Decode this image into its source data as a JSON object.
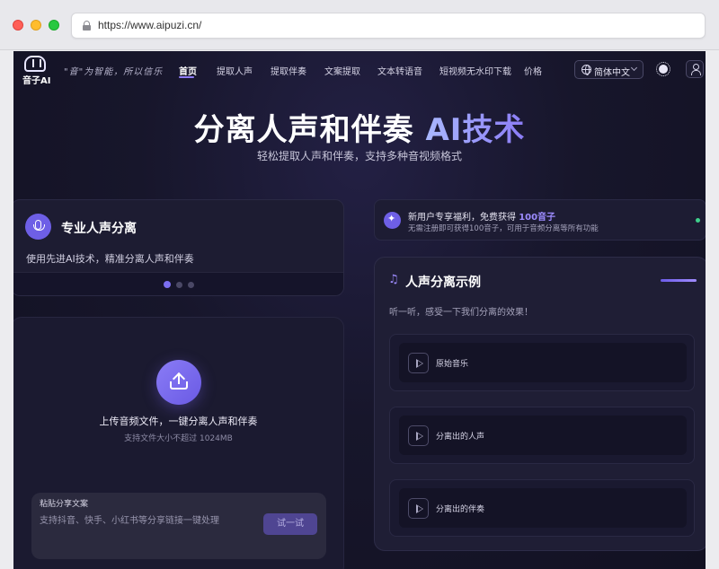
{
  "browser": {
    "url": "https://www.aipuzi.cn/"
  },
  "nav": {
    "logo_text": "音子AI",
    "slogan": "\"音\"为智能，所以信乐",
    "items": [
      {
        "label": "首页",
        "active": true
      },
      {
        "label": "提取人声"
      },
      {
        "label": "提取伴奏"
      },
      {
        "label": "文案提取"
      },
      {
        "label": "文本转语音"
      },
      {
        "label": "短视频无水印下载"
      },
      {
        "label": "价格"
      }
    ],
    "language": "简体中文"
  },
  "hero": {
    "title_main": "分离人声和伴奏 ",
    "title_accent": "AI技术",
    "subtitle": "轻松提取人声和伴奏，支持多种音视频格式"
  },
  "feature_card": {
    "title": "专业人声分离",
    "description": "使用先进AI技术，精准分离人声和伴奏",
    "pagination": {
      "total": 3,
      "active": 1
    }
  },
  "upload": {
    "title": "上传音频文件，一键分离人声和伴奏",
    "hint": "支持文件大小不超过 1024MB",
    "share_label": "粘贴分享文案",
    "share_placeholder": "支持抖音、快手、小红书等分享链接一键处理",
    "share_button": "试一试"
  },
  "promo": {
    "line1_prefix": "新用户专享福利，免费获得 ",
    "line1_highlight": "100音子",
    "line2": "无需注册即可获得100音子，可用于音频分离等所有功能"
  },
  "examples": {
    "title": "人声分离示例",
    "subtitle": "听一听，感受一下我们分离的效果！",
    "items": [
      {
        "label": "原始音乐"
      },
      {
        "label": "分离出的人声"
      },
      {
        "label": "分离出的伴奏"
      }
    ]
  },
  "colors": {
    "accent": "#7b6ef0",
    "background": "#17162b",
    "status_dot": "#3fd08c"
  }
}
